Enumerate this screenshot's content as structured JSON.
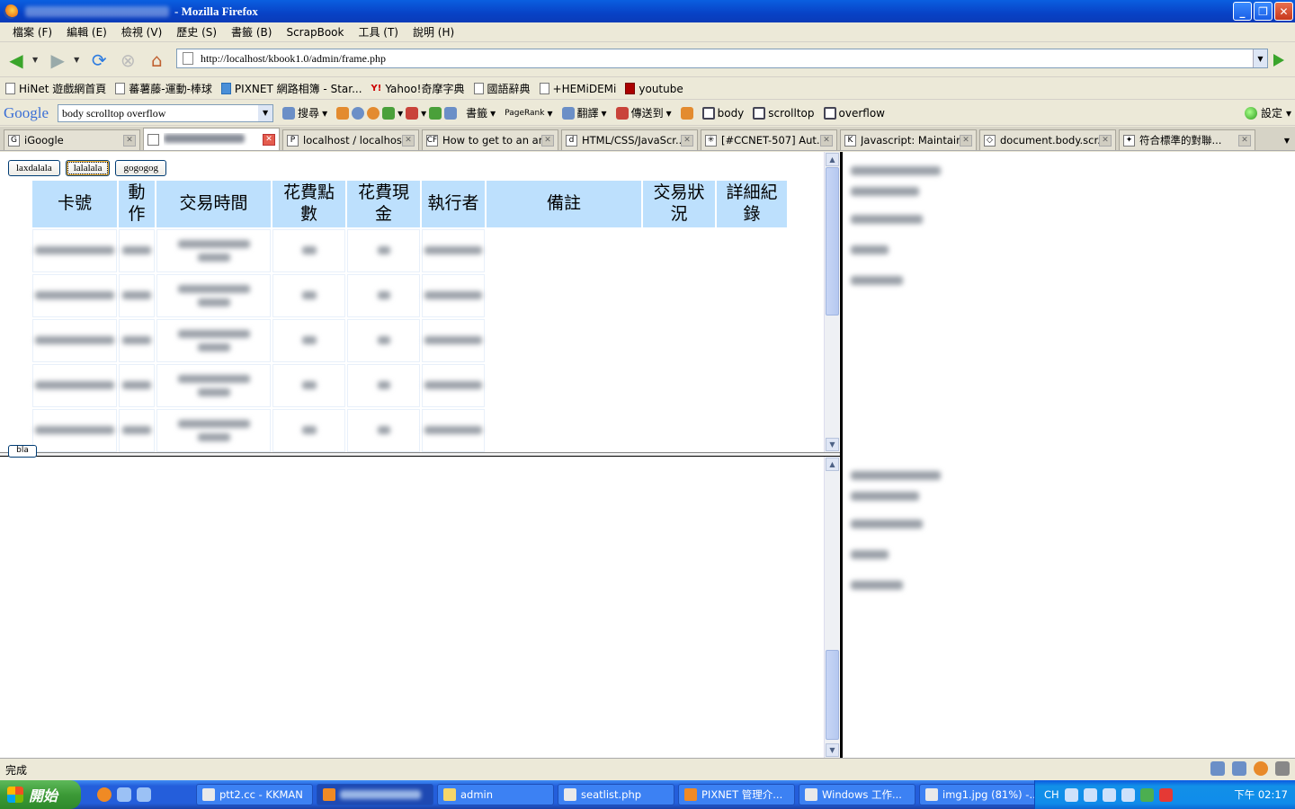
{
  "window": {
    "title": "- Mozilla Firefox"
  },
  "menu": [
    "檔案 (F)",
    "編輯 (E)",
    "檢視 (V)",
    "歷史 (S)",
    "書籤 (B)",
    "ScrapBook",
    "工具 (T)",
    "說明 (H)"
  ],
  "nav": {
    "url": "http://localhost/kbook1.0/admin/frame.php"
  },
  "bookmarks": [
    {
      "label": "HiNet 遊戲網首頁",
      "icon": "page-icon"
    },
    {
      "label": "蕃薯藤-運動-棒球",
      "icon": "page-icon"
    },
    {
      "label": "PIXNET 網路相簿 - Star...",
      "icon": "pixnet-icon"
    },
    {
      "label": "Yahoo!奇摩字典",
      "icon": "yahoo-icon"
    },
    {
      "label": "國語辭典",
      "icon": "page-icon"
    },
    {
      "label": "+HEMiDEMi",
      "icon": "page-icon"
    },
    {
      "label": "youtube",
      "icon": "youtube-icon"
    }
  ],
  "google_toolbar": {
    "logo": "Google",
    "query": "body scrolltop overflow",
    "search_label": "搜尋",
    "bookmarks_label": "書籤",
    "pagerank_label": "PageRank",
    "translate_label": "翻譯",
    "sendto_label": "傳送到",
    "highlights": [
      "body",
      "scrolltop",
      "overflow"
    ],
    "settings_label": "設定"
  },
  "tabs": [
    {
      "label": "iGoogle",
      "active": false
    },
    {
      "label": "",
      "active": true
    },
    {
      "label": "localhost / localhost ...",
      "active": false
    },
    {
      "label": "How to get to an an...",
      "active": false
    },
    {
      "label": "HTML/CSS/JavaScr...",
      "active": false
    },
    {
      "label": "[#CCNET-507] Aut...",
      "active": false
    },
    {
      "label": "Javascript: Maintain...",
      "active": false
    },
    {
      "label": "document.body.scr...",
      "active": false
    },
    {
      "label": "符合標準的對聯...",
      "active": false
    }
  ],
  "frame_buttons": [
    "laxdalala",
    "lalalala",
    "gogogog"
  ],
  "table": {
    "headers": [
      "卡號",
      "動作",
      "交易時間",
      "花費點數",
      "花費現金",
      "執行者",
      "備註",
      "交易狀況",
      "詳細紀錄"
    ],
    "header_lines": [
      [
        "卡號"
      ],
      [
        "動",
        "作"
      ],
      [
        "交易時間"
      ],
      [
        "花費點",
        "數"
      ],
      [
        "花費現",
        "金"
      ],
      [
        "執行者"
      ],
      [
        "備註"
      ],
      [
        "交易狀",
        "況"
      ],
      [
        "詳細紀",
        "錄"
      ]
    ],
    "row_count": 5
  },
  "small_button": "bla",
  "status": {
    "text": "完成"
  },
  "taskbar": {
    "start": "開始",
    "tasks": [
      {
        "label": "ptt2.cc - KKMAN",
        "active": false
      },
      {
        "label": "",
        "active": true
      },
      {
        "label": "admin",
        "active": false
      },
      {
        "label": "seatlist.php",
        "active": false
      },
      {
        "label": "PIXNET 管理介...",
        "active": false
      },
      {
        "label": "Windows 工作...",
        "active": false
      },
      {
        "label": "img1.jpg (81%) -...",
        "active": false
      }
    ],
    "lang": "CH",
    "clock": "下午 02:17"
  }
}
